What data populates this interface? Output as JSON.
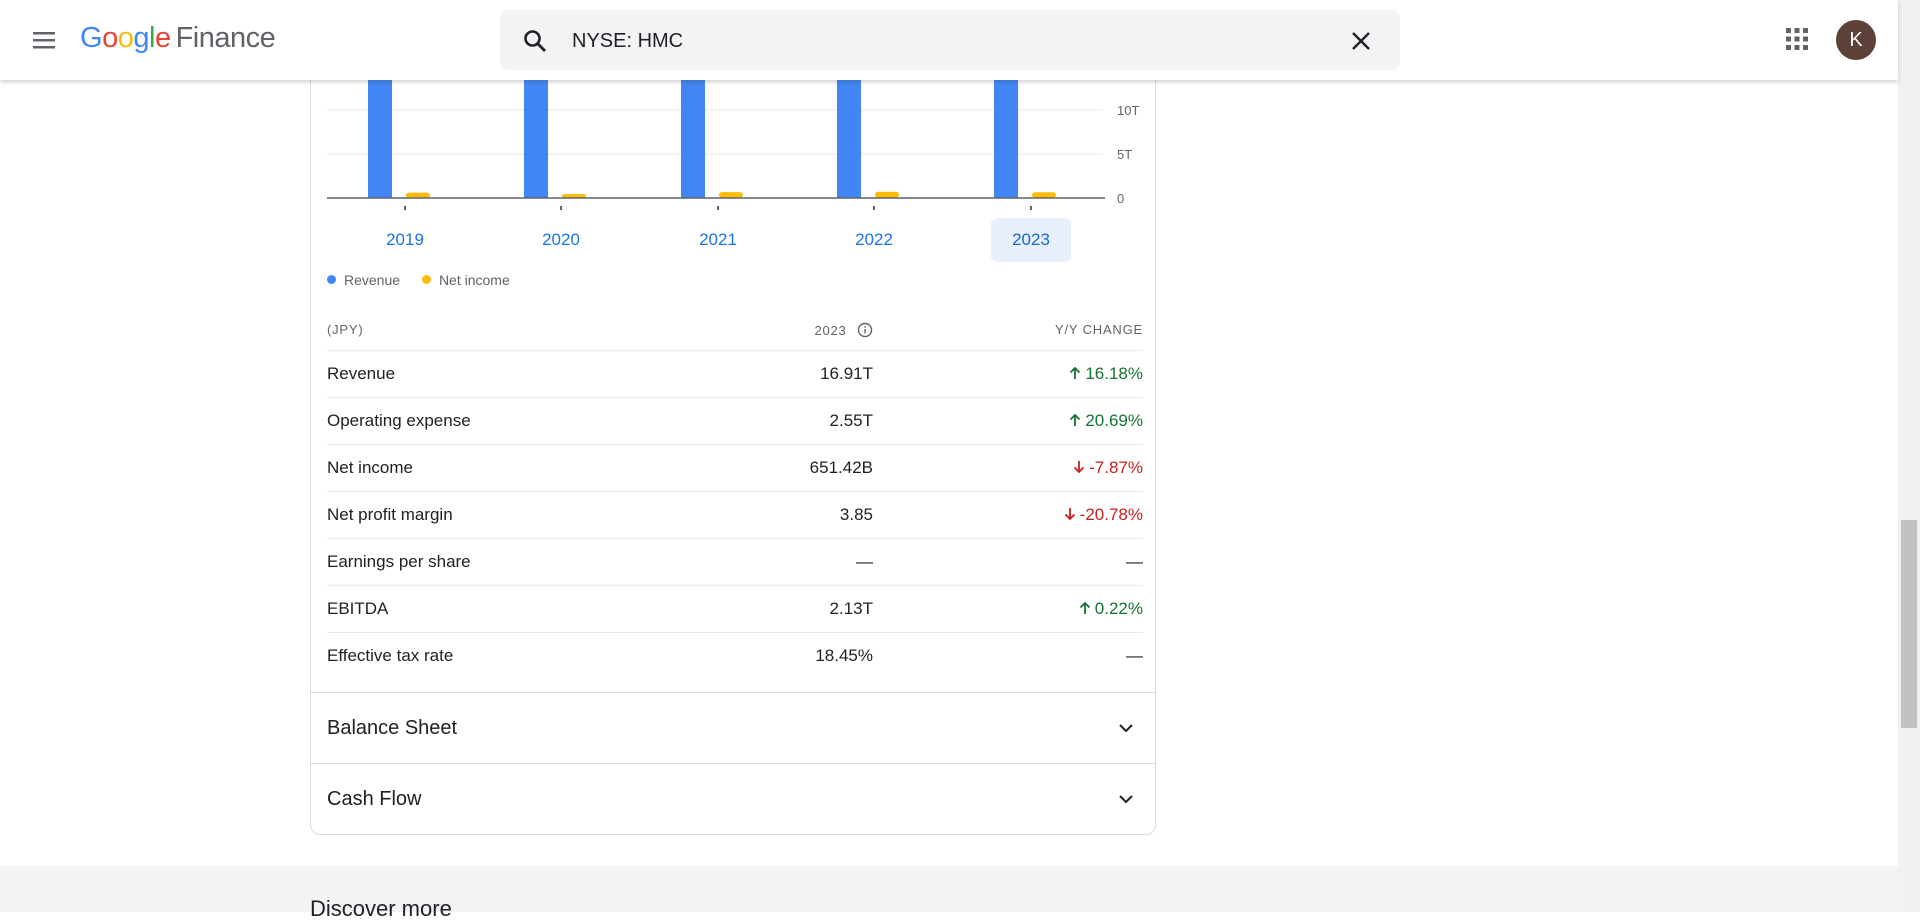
{
  "header": {
    "logo_google": [
      "G",
      "o",
      "o",
      "g",
      "l",
      "e"
    ],
    "logo_product": "Finance",
    "search_value": "NYSE: HMC",
    "avatar_letter": "K"
  },
  "chart_data": {
    "type": "bar",
    "categories": [
      "2019",
      "2020",
      "2021",
      "2022",
      "2023"
    ],
    "series": [
      {
        "name": "Revenue",
        "color": "#4285f4",
        "values": [
          15.9,
          14.9,
          14.5,
          16.5,
          16.9
        ]
      },
      {
        "name": "Net income",
        "color": "#fbbc04",
        "values": [
          0.61,
          0.46,
          0.67,
          0.71,
          0.65
        ]
      }
    ],
    "y_unit": "T",
    "y_ticks": [
      "0",
      "5T",
      "10T"
    ],
    "ylim": [
      0,
      17
    ],
    "selected_category": "2023",
    "grid": true,
    "legend_position": "bottom-left"
  },
  "legend": [
    {
      "label": "Revenue",
      "color": "#4285f4"
    },
    {
      "label": "Net income",
      "color": "#fbbc04"
    }
  ],
  "table": {
    "col_currency": "(JPY)",
    "col_period": "2023",
    "col_change": "Y/Y CHANGE",
    "rows": [
      {
        "label": "Revenue",
        "value": "16.91T",
        "change": "16.18%",
        "dir": "up"
      },
      {
        "label": "Operating expense",
        "value": "2.55T",
        "change": "20.69%",
        "dir": "up"
      },
      {
        "label": "Net income",
        "value": "651.42B",
        "change": "-7.87%",
        "dir": "down"
      },
      {
        "label": "Net profit margin",
        "value": "3.85",
        "change": "-20.78%",
        "dir": "down"
      },
      {
        "label": "Earnings per share",
        "value": "—",
        "change": "—",
        "dir": "none"
      },
      {
        "label": "EBITDA",
        "value": "2.13T",
        "change": "0.22%",
        "dir": "up"
      },
      {
        "label": "Effective tax rate",
        "value": "18.45%",
        "change": "—",
        "dir": "none"
      }
    ]
  },
  "sections": [
    {
      "label": "Balance Sheet"
    },
    {
      "label": "Cash Flow"
    }
  ],
  "discover_title": "Discover more"
}
